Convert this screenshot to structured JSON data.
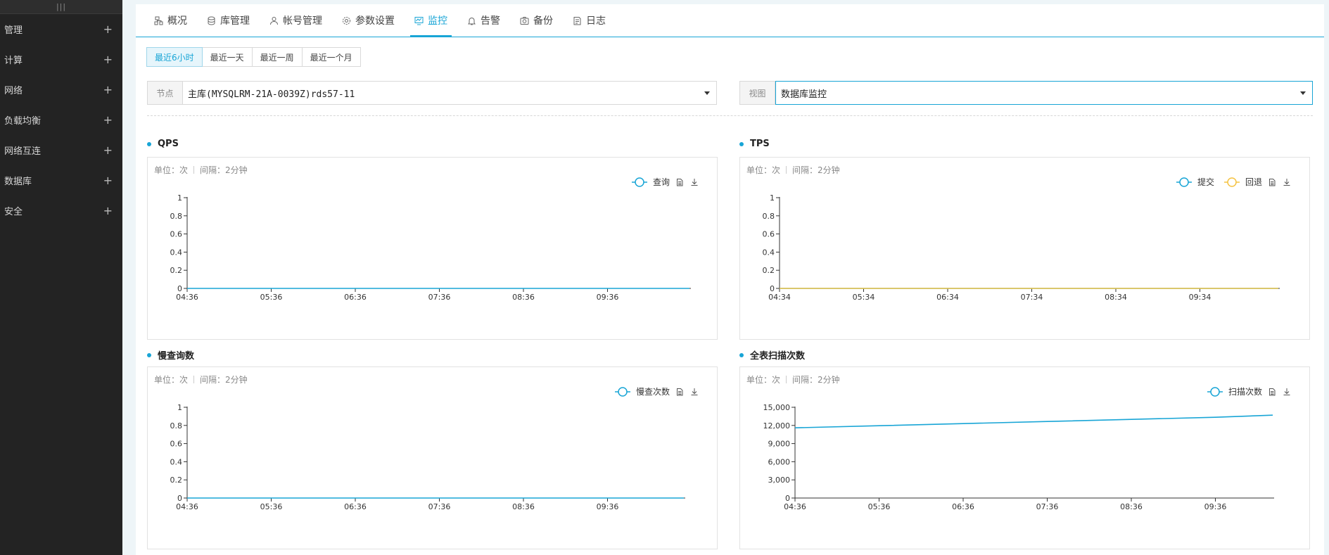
{
  "sidebar": {
    "collapse_glyph": "|||",
    "items": [
      {
        "label": "管理"
      },
      {
        "label": "计算"
      },
      {
        "label": "网络"
      },
      {
        "label": "负载均衡"
      },
      {
        "label": "网络互连"
      },
      {
        "label": "数据库"
      },
      {
        "label": "安全"
      }
    ],
    "expand_icon": "plus-icon"
  },
  "tabs": [
    {
      "label": "概况",
      "icon": "overview-icon"
    },
    {
      "label": "库管理",
      "icon": "database-icon"
    },
    {
      "label": "帐号管理",
      "icon": "user-icon"
    },
    {
      "label": "参数设置",
      "icon": "gear-icon"
    },
    {
      "label": "监控",
      "icon": "monitor-icon",
      "active": true
    },
    {
      "label": "告警",
      "icon": "bell-icon"
    },
    {
      "label": "备份",
      "icon": "camera-icon"
    },
    {
      "label": "日志",
      "icon": "log-icon"
    }
  ],
  "time_ranges": [
    {
      "label": "最近6小时",
      "active": true
    },
    {
      "label": "最近一天"
    },
    {
      "label": "最近一周"
    },
    {
      "label": "最近一个月"
    }
  ],
  "node_select": {
    "label": "节点",
    "value": "主库(MYSQLRM-21A-0039Z)rds57-11"
  },
  "view_select": {
    "label": "视图",
    "value": "数据库监控"
  },
  "colors": {
    "accent": "#18a5d6",
    "secondary": "#f5c342"
  },
  "panels": [
    {
      "title": "QPS",
      "unit": "单位：次",
      "interval": "间隔：2分钟",
      "legend": [
        "查询"
      ]
    },
    {
      "title": "TPS",
      "unit": "单位：次",
      "interval": "间隔：2分钟",
      "legend": [
        "提交",
        "回退"
      ]
    },
    {
      "title": "慢查询数",
      "unit": "单位：次",
      "interval": "间隔：2分钟",
      "legend": [
        "慢查次数"
      ]
    },
    {
      "title": "全表扫描次数",
      "unit": "单位：次",
      "interval": "间隔：2分钟",
      "legend": [
        "扫描次数"
      ]
    }
  ],
  "chart_data": [
    {
      "type": "line",
      "x": [
        "04:36",
        "05:36",
        "06:36",
        "07:36",
        "08:36",
        "09:36"
      ],
      "yticks": [
        "0",
        "0.2",
        "0.4",
        "0.6",
        "0.8",
        "1"
      ],
      "ylim": [
        0,
        1
      ],
      "series": [
        {
          "name": "查询",
          "values": [
            0,
            0,
            0,
            0,
            0,
            0,
            0
          ],
          "color": "#18a5d6"
        }
      ]
    },
    {
      "type": "line",
      "x": [
        "04:34",
        "05:34",
        "06:34",
        "07:34",
        "08:34",
        "09:34"
      ],
      "yticks": [
        "0",
        "0.2",
        "0.4",
        "0.6",
        "0.8",
        "1"
      ],
      "ylim": [
        0,
        1
      ],
      "series": [
        {
          "name": "提交",
          "values": [
            0,
            0,
            0,
            0,
            0,
            0,
            0
          ],
          "color": "#18a5d6"
        },
        {
          "name": "回退",
          "values": [
            0,
            0,
            0,
            0,
            0,
            0,
            0
          ],
          "color": "#f5c342"
        }
      ]
    },
    {
      "type": "line",
      "x": [
        "04:36",
        "05:36",
        "06:36",
        "07:36",
        "08:36",
        "09:36"
      ],
      "yticks": [
        "0",
        "0.2",
        "0.4",
        "0.6",
        "0.8",
        "1"
      ],
      "ylim": [
        0,
        1
      ],
      "series": [
        {
          "name": "慢查次数",
          "values": [
            0,
            0,
            0,
            0,
            0,
            0,
            0
          ],
          "color": "#18a5d6"
        }
      ]
    },
    {
      "type": "line",
      "x": [
        "04:36",
        "05:36",
        "06:36",
        "07:36",
        "08:36",
        "09:36"
      ],
      "yticks": [
        "0",
        "3,000",
        "6,000",
        "9,000",
        "12,000",
        "15,000"
      ],
      "ylim": [
        0,
        15000
      ],
      "series": [
        {
          "name": "扫描次数",
          "values": [
            11600,
            11950,
            12300,
            12650,
            13000,
            13350,
            13700
          ],
          "color": "#18a5d6"
        }
      ]
    }
  ]
}
